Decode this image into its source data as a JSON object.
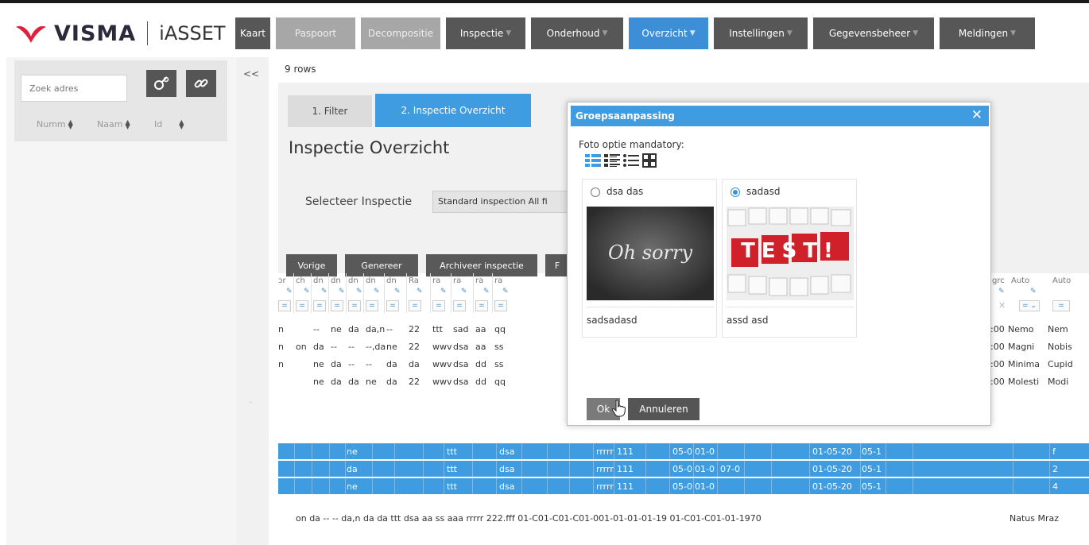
{
  "header": {
    "brand": "VISMA",
    "product": "iASSET",
    "nav": [
      {
        "label": "Kaart",
        "state": "normal",
        "caret": false
      },
      {
        "label": "Paspoort",
        "state": "disabled",
        "caret": false
      },
      {
        "label": "Decompositie",
        "state": "disabled",
        "caret": false
      },
      {
        "label": "Inspectie",
        "state": "normal",
        "caret": true
      },
      {
        "label": "Onderhoud",
        "state": "normal",
        "caret": true
      },
      {
        "label": "Overzicht",
        "state": "active",
        "caret": true
      },
      {
        "label": "Instellingen",
        "state": "normal",
        "caret": true
      },
      {
        "label": "Gegevensbeheer",
        "state": "normal",
        "caret": true
      },
      {
        "label": "Meldingen",
        "state": "normal",
        "caret": true
      }
    ]
  },
  "sidebar": {
    "search_placeholder": "Zoek adres",
    "search_icon": "search-key-icon",
    "link_icon": "link-icon",
    "sort_fields": [
      "Numm",
      "Naam",
      "Id"
    ]
  },
  "collapse": {
    "label": "<<",
    "dot": "·"
  },
  "main": {
    "row_count": "9 rows",
    "tabs": [
      "1. Filter",
      "2. Inspectie Overzicht"
    ],
    "title": "Inspectie Overzicht",
    "selecteer_label": "Selecteer Inspectie",
    "selecteer_value": "Standard inspection All fi",
    "buttons": [
      "Vorige",
      "Genereer",
      "Archiveer inspectie",
      "F"
    ]
  },
  "grid": {
    "headers": [
      "ɔr",
      "ch",
      "dn",
      "dn",
      "dn",
      "dn",
      "dn",
      "Ra",
      "ra",
      "ra",
      "ra",
      "ra"
    ],
    "right_headers": [
      "grc",
      "Auto",
      "Auto"
    ],
    "rows": [
      [
        "n",
        "",
        "--",
        "ne",
        "da",
        "da,n",
        "--",
        "22",
        "ttt",
        "sad",
        "aa",
        "qq"
      ],
      [
        "n",
        "on",
        "da",
        "--",
        "--",
        "--,da",
        "ne",
        "22",
        "wwv",
        "dsa",
        "aa",
        "ss"
      ],
      [
        "n",
        "",
        "ne",
        "da",
        "--",
        "--",
        "da",
        "da",
        "wwv",
        "dsa",
        "dd",
        "ss"
      ],
      [
        "",
        "",
        "ne",
        "da",
        "da",
        "ne",
        "da",
        "22",
        "wwv",
        "dsa",
        "dd",
        "qq"
      ]
    ],
    "rows_right": [
      [
        ":00",
        "Nemo",
        "Nem"
      ],
      [
        ":00",
        "Magni",
        "Nobis"
      ],
      [
        ":00",
        "Minima",
        "Cupid"
      ],
      [
        ":00",
        "Molesti",
        "Modi"
      ]
    ],
    "selected_rows": [
      {
        "c3": "ne",
        "c8": "ttt",
        "c9": "dsa",
        "r1": "rrrrr",
        "r2": "111",
        "r3": "05-0",
        "r4": "01-0",
        "r5": "",
        "r6": "01-05-20",
        "r7": "05-1",
        "last": "f"
      },
      {
        "c3": "da",
        "c8": "ttt",
        "c9": "dsa",
        "r1": "rrrrr",
        "r2": "111",
        "r3": "05-0",
        "r4": "01-0",
        "r5": "07-0",
        "r6": "01-05-20",
        "r7": "05-1",
        "last": "2"
      },
      {
        "c3": "ne",
        "c8": "ttt",
        "c9": "dsa",
        "r1": "rrrrr",
        "r2": "111",
        "r3": "05-0",
        "r4": "01-0",
        "r5": "",
        "r6": "01-05-20",
        "r7": "05-1",
        "last": "4"
      }
    ],
    "last_row": "on  da  --  --  da,n da  da  ttt  dsa aa  ss  aaa rrrrr 222.fff  01-C01-C01-C01-001-01-01-01-19 01-C01-C01-01-1970",
    "last_row_right": "Natus Mraz"
  },
  "modal": {
    "title": "Groepsaanpassing",
    "close": "✕",
    "foto_label": "Foto optie mandatory:",
    "options": [
      {
        "name": "dsa das",
        "checked": false,
        "image_text": "Oh sorry",
        "desc": "sadsadasd"
      },
      {
        "name": "sadasd",
        "checked": true,
        "image_text": "TEST!",
        "desc": "assd asd"
      }
    ],
    "ok": "Ok",
    "cancel": "Annuleren"
  },
  "colors": {
    "accent": "#3f9ce0",
    "nav_bg": "#575757",
    "nav_disabled": "#a7a7a7",
    "brand_red": "#e0213e"
  }
}
